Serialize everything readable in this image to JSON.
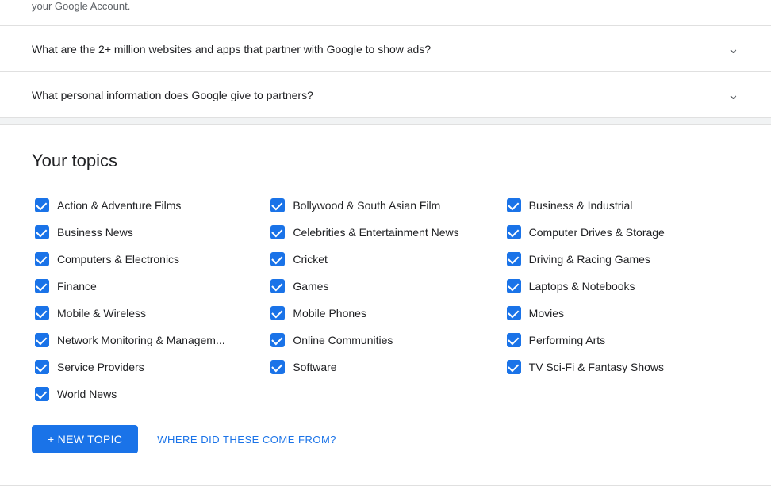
{
  "page": {
    "top_text": "your Google Account.",
    "faq": [
      {
        "id": "faq1",
        "question": "What are the 2+ million websites and apps that partner with Google to show ads?"
      },
      {
        "id": "faq2",
        "question": "What personal information does Google give to partners?"
      }
    ],
    "topics_section": {
      "title": "Your topics",
      "columns": [
        {
          "items": [
            "Action & Adventure Films",
            "Business News",
            "Computers & Electronics",
            "Finance",
            "Mobile & Wireless",
            "Network Monitoring & Managem...",
            "Service Providers",
            "World News"
          ]
        },
        {
          "items": [
            "Bollywood & South Asian Film",
            "Celebrities & Entertainment News",
            "Cricket",
            "Games",
            "Mobile Phones",
            "Online Communities",
            "Software"
          ]
        },
        {
          "items": [
            "Business & Industrial",
            "Computer Drives & Storage",
            "Driving & Racing Games",
            "Laptops & Notebooks",
            "Movies",
            "Performing Arts",
            "TV Sci-Fi & Fantasy Shows"
          ]
        }
      ],
      "new_topic_label": "+ NEW TOPIC",
      "where_label": "WHERE DID THESE COME FROM?"
    }
  }
}
